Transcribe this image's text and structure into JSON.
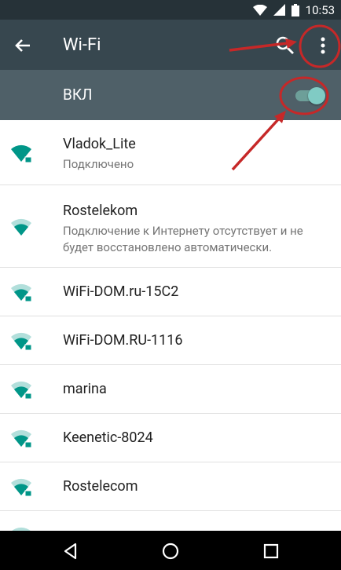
{
  "status_bar": {
    "time": "10:53"
  },
  "toolbar": {
    "title": "Wi-Fi"
  },
  "wifi_switch": {
    "label": "ВКЛ",
    "state": "on"
  },
  "colors": {
    "accent": "#80cbc4",
    "wifi_icon": "#009688",
    "toolbar": "#37474f",
    "switchbar": "#4f6068",
    "annotation": "#c62828"
  },
  "networks": [
    {
      "ssid": "Vladok_Lite",
      "status": "Подключено",
      "signal": "full",
      "locked": true
    },
    {
      "ssid": "Rostelekom",
      "status": "Подключение к Интернету отсутствует и не будет восстановлено автоматически.",
      "signal": "medium",
      "locked": false
    },
    {
      "ssid": "WiFi-DOM.ru-15C2",
      "status": "",
      "signal": "medium",
      "locked": true
    },
    {
      "ssid": "WiFi-DOM.RU-1116",
      "status": "",
      "signal": "medium",
      "locked": true
    },
    {
      "ssid": "marina",
      "status": "",
      "signal": "medium",
      "locked": true
    },
    {
      "ssid": "Keenetic-8024",
      "status": "",
      "signal": "medium",
      "locked": true
    },
    {
      "ssid": "Rostelecom",
      "status": "",
      "signal": "medium",
      "locked": true
    }
  ]
}
